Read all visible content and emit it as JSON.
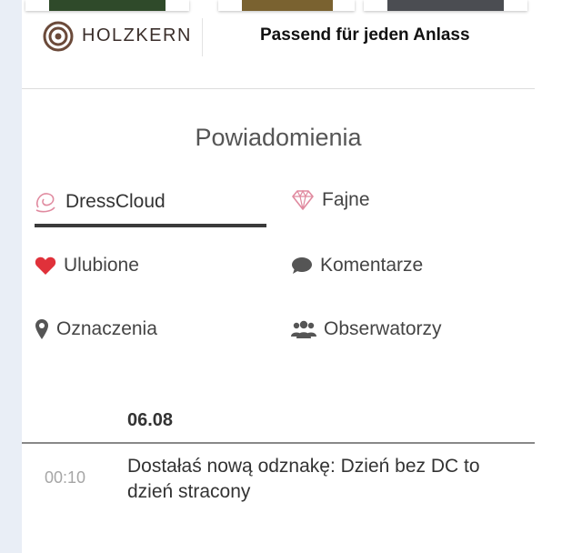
{
  "ad": {
    "brand": "HOLZKERN",
    "slogan": "Passend für jeden Anlass"
  },
  "page_title": "Powiadomienia",
  "filters": [
    {
      "label": "DressCloud",
      "icon": "dresscloud-logo-icon",
      "active": true
    },
    {
      "label": "Fajne",
      "icon": "diamond-icon"
    },
    {
      "label": "Ulubione",
      "icon": "heart-icon"
    },
    {
      "label": "Komentarze",
      "icon": "speech-bubble-icon"
    },
    {
      "label": "Oznaczenia",
      "icon": "map-pin-icon"
    },
    {
      "label": "Obserwatorzy",
      "icon": "users-icon"
    }
  ],
  "notifications": {
    "date": "06.08",
    "items": [
      {
        "time": "00:10",
        "text": "Dostałaś nową odznakę: Dzień bez DC to dzień stracony"
      }
    ]
  },
  "colors": {
    "accent_pink": "#e08a9f",
    "heart_red": "#e0313a",
    "active_underline": "#3b3b3b"
  }
}
